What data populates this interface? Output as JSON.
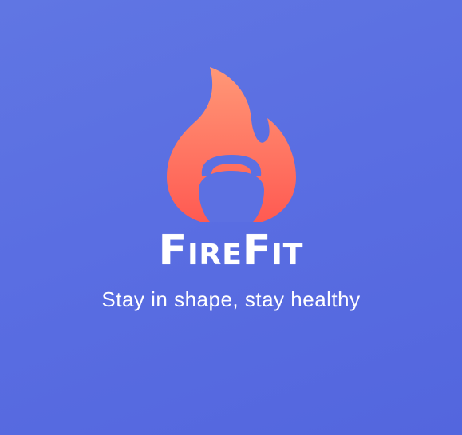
{
  "app": {
    "title": "FireFit",
    "tagline": "Stay in shape, stay healthy"
  },
  "logo": {
    "icon": "flame-kettlebell-icon"
  },
  "colors": {
    "background": "#5b6fe2",
    "flame_top": "#ff8f72",
    "flame_bottom": "#ff5a52",
    "text": "#ffffff"
  }
}
